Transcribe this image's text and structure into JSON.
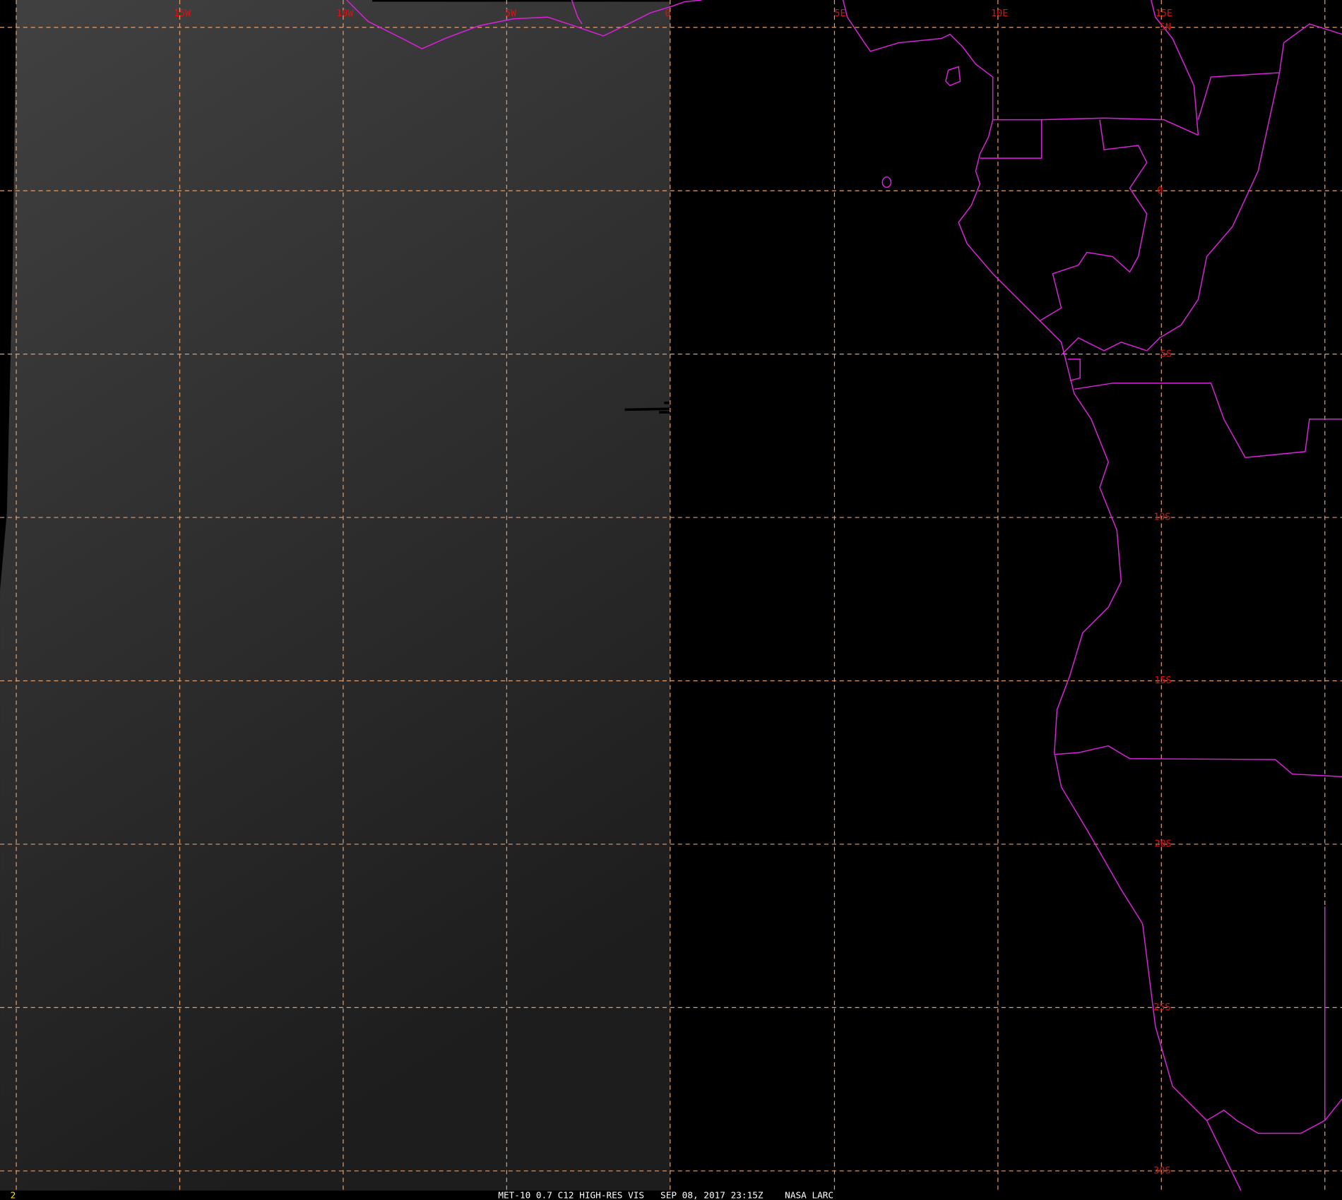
{
  "map": {
    "frame_number": "2",
    "caption": "MET-10 0.7 C12 HIGH-RES VIS   SEP 08, 2017 23:15Z    NASA LARC",
    "longitude_labels": [
      "15W",
      "10W",
      "5W",
      "0",
      "5E",
      "10E",
      "15E"
    ],
    "latitude_labels": [
      "5N",
      "0",
      "5S",
      "10S",
      "15S",
      "20S",
      "25S",
      "30S"
    ],
    "colors": {
      "grid": "#e0a070",
      "coastline": "#e020e0",
      "labels": "#e01010",
      "caption": "#ffffff",
      "frame_number": "#ffe020"
    }
  }
}
